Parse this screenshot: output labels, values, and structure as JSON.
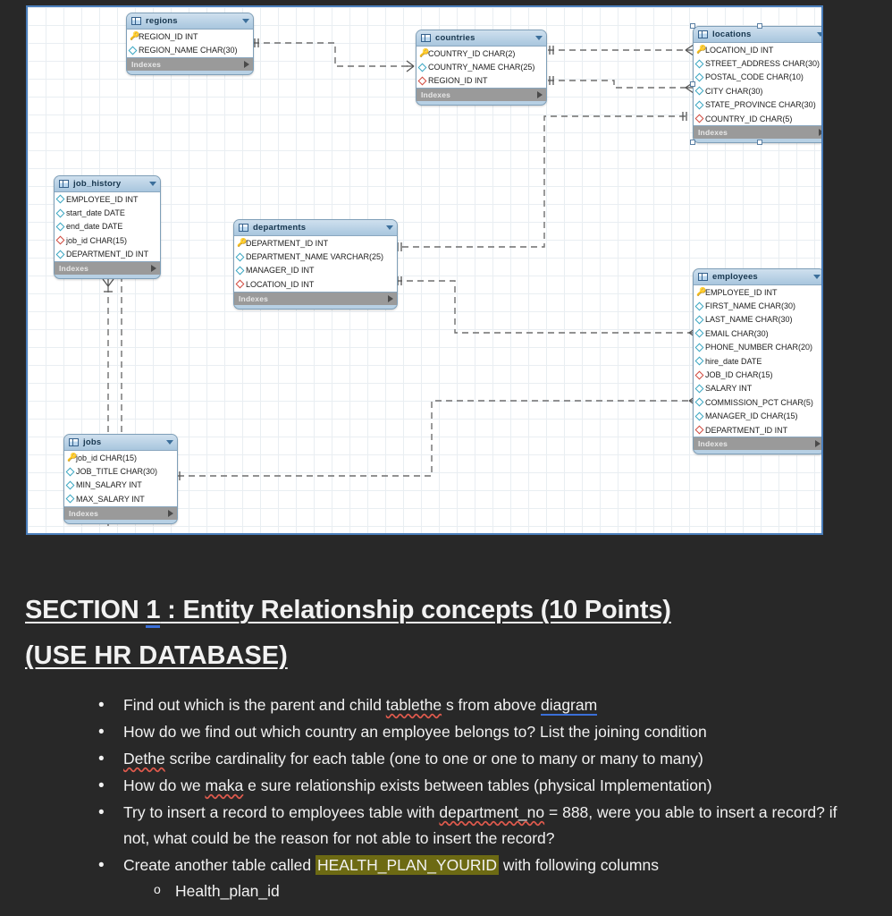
{
  "diagram": {
    "title": "HR database ER diagram",
    "indexes_label": "Indexes",
    "tables": [
      {
        "name": "regions",
        "columns": [
          {
            "icon": "pk",
            "text": "REGION_ID INT"
          },
          {
            "icon": "col",
            "text": "REGION_NAME CHAR(30)"
          }
        ]
      },
      {
        "name": "countries",
        "columns": [
          {
            "icon": "pk",
            "text": "COUNTRY_ID CHAR(2)"
          },
          {
            "icon": "col",
            "text": "COUNTRY_NAME CHAR(25)"
          },
          {
            "icon": "fk",
            "text": "REGION_ID INT"
          }
        ]
      },
      {
        "name": "locations",
        "columns": [
          {
            "icon": "pk",
            "text": "LOCATION_ID INT"
          },
          {
            "icon": "col",
            "text": "STREET_ADDRESS CHAR(30)"
          },
          {
            "icon": "col",
            "text": "POSTAL_CODE CHAR(10)"
          },
          {
            "icon": "col",
            "text": "CITY CHAR(30)"
          },
          {
            "icon": "col",
            "text": "STATE_PROVINCE CHAR(30)"
          },
          {
            "icon": "fk",
            "text": "COUNTRY_ID CHAR(5)"
          }
        ]
      },
      {
        "name": "job_history",
        "columns": [
          {
            "icon": "col",
            "text": "EMPLOYEE_ID INT"
          },
          {
            "icon": "col",
            "text": "start_date DATE"
          },
          {
            "icon": "col",
            "text": "end_date DATE"
          },
          {
            "icon": "fk",
            "text": "job_id CHAR(15)"
          },
          {
            "icon": "col",
            "text": "DEPARTMENT_ID INT"
          }
        ]
      },
      {
        "name": "departments",
        "columns": [
          {
            "icon": "pk",
            "text": "DEPARTMENT_ID INT"
          },
          {
            "icon": "col",
            "text": "DEPARTMENT_NAME VARCHAR(25)"
          },
          {
            "icon": "col",
            "text": "MANAGER_ID INT"
          },
          {
            "icon": "fk",
            "text": "LOCATION_ID INT"
          }
        ]
      },
      {
        "name": "employees",
        "columns": [
          {
            "icon": "pk",
            "text": "EMPLOYEE_ID INT"
          },
          {
            "icon": "col",
            "text": "FIRST_NAME CHAR(30)"
          },
          {
            "icon": "col",
            "text": "LAST_NAME CHAR(30)"
          },
          {
            "icon": "col",
            "text": "EMAIL CHAR(30)"
          },
          {
            "icon": "col",
            "text": "PHONE_NUMBER CHAR(20)"
          },
          {
            "icon": "col",
            "text": "hire_date DATE"
          },
          {
            "icon": "fk",
            "text": "JOB_ID CHAR(15)"
          },
          {
            "icon": "col",
            "text": "SALARY INT"
          },
          {
            "icon": "col",
            "text": "COMMISSION_PCT CHAR(5)"
          },
          {
            "icon": "col",
            "text": "MANAGER_ID CHAR(15)"
          },
          {
            "icon": "fk",
            "text": "DEPARTMENT_ID INT"
          }
        ]
      },
      {
        "name": "jobs",
        "columns": [
          {
            "icon": "pk",
            "text": "job_id CHAR(15)"
          },
          {
            "icon": "col",
            "text": "JOB_TITLE CHAR(30)"
          },
          {
            "icon": "col",
            "text": "MIN_SALARY INT"
          },
          {
            "icon": "col",
            "text": "MAX_SALARY INT"
          }
        ]
      }
    ]
  },
  "document": {
    "heading": {
      "prefix": "SECTION ",
      "number": "1",
      "rest": " :  Entity Relationship concepts (10 Points)"
    },
    "subheading": "(USE HR DATABASE)",
    "bullets": [
      {
        "parts": [
          {
            "text": "Find out which is the parent and child ",
            "style": "plain"
          },
          {
            "text": "tablethe",
            "style": "spell-error"
          },
          {
            "text": " s from above ",
            "style": "plain"
          },
          {
            "text": "diagram",
            "style": "hyperlink"
          }
        ]
      },
      {
        "parts": [
          {
            "text": "How do we find out which country an employee belongs to? List the joining condition",
            "style": "plain"
          }
        ]
      },
      {
        "parts": [
          {
            "text": "Dethe",
            "style": "spell-error"
          },
          {
            "text": " scribe cardinality for each table (one to one or one to many or many to many)",
            "style": "plain"
          }
        ]
      },
      {
        "parts": [
          {
            "text": "How do we ",
            "style": "plain"
          },
          {
            "text": "maka",
            "style": "spell-error"
          },
          {
            "text": " e sure relationship exists between tables (physical Implementation)",
            "style": "plain"
          }
        ]
      },
      {
        "parts": [
          {
            "text": "Try to insert a record to employees table with ",
            "style": "plain"
          },
          {
            "text": "department_no",
            "style": "spell-error"
          },
          {
            "text": " = 888, were you able to insert a record? if not, what could be the reason for not able to insert the record?",
            "style": "plain"
          }
        ]
      },
      {
        "parts": [
          {
            "text": " Create another table called ",
            "style": "plain"
          },
          {
            "text": "HEALTH_PLAN_YOURID",
            "style": "highlight"
          },
          {
            "text": " with following columns",
            "style": "plain"
          }
        ],
        "sub": [
          "Health_plan_id"
        ]
      }
    ]
  },
  "colors": {
    "page_background": "#282828",
    "text": "#f2f2f2",
    "highlight": "#6d6a13",
    "hyperlink_underline": "#3a6fd8",
    "spell_error": "#e05a4d",
    "canvas_border": "#4a7ebb",
    "table_header": "#a8c6de",
    "table_footer": "#9a9a9a",
    "connector": "#6f6f6f"
  }
}
